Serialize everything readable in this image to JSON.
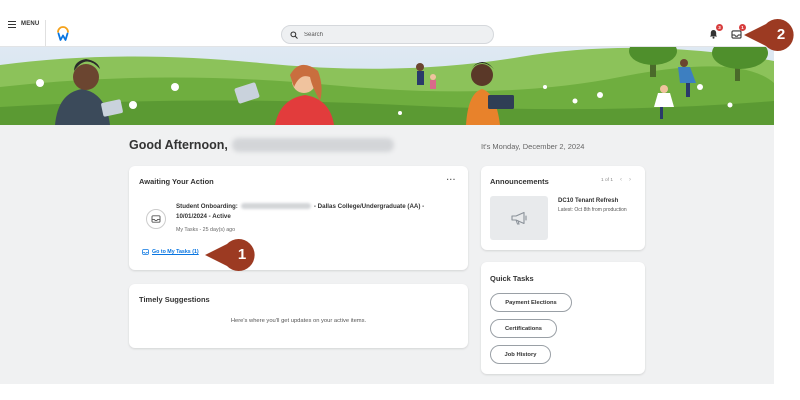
{
  "header": {
    "menu_label": "MENU",
    "search_placeholder": "Search",
    "notifications_count": "3",
    "inbox_count": "1"
  },
  "greeting": {
    "text": "Good Afternoon,",
    "date": "It's Monday, December 2, 2024"
  },
  "awaiting": {
    "title": "Awaiting Your Action",
    "more": "···",
    "task_title_prefix": "Student Onboarding:",
    "task_title_suffix": "- Dallas College/Undergraduate (AA) - 10/01/2024 - Active",
    "task_meta": "My Tasks - 25 day(s) ago",
    "link_label": "Go to My Tasks (1)"
  },
  "timely": {
    "title": "Timely Suggestions",
    "message": "Here's where you'll get updates on your active items."
  },
  "announcements": {
    "title": "Announcements",
    "pager": "1 of 1",
    "item_title": "DC10 Tenant Refresh",
    "item_subtitle": "Latest: Oct 8th from production"
  },
  "quick_tasks": {
    "title": "Quick Tasks",
    "buttons": [
      "Payment Elections",
      "Certifications",
      "Job History"
    ]
  },
  "callouts": [
    "1",
    "2"
  ],
  "colors": {
    "accent": "#0875e1",
    "badge": "#d73d3d",
    "callout": "#9c3a22",
    "banner_grass": "#6fae3f",
    "logo_orange": "#f4a21c",
    "logo_blue": "#0875e1"
  }
}
